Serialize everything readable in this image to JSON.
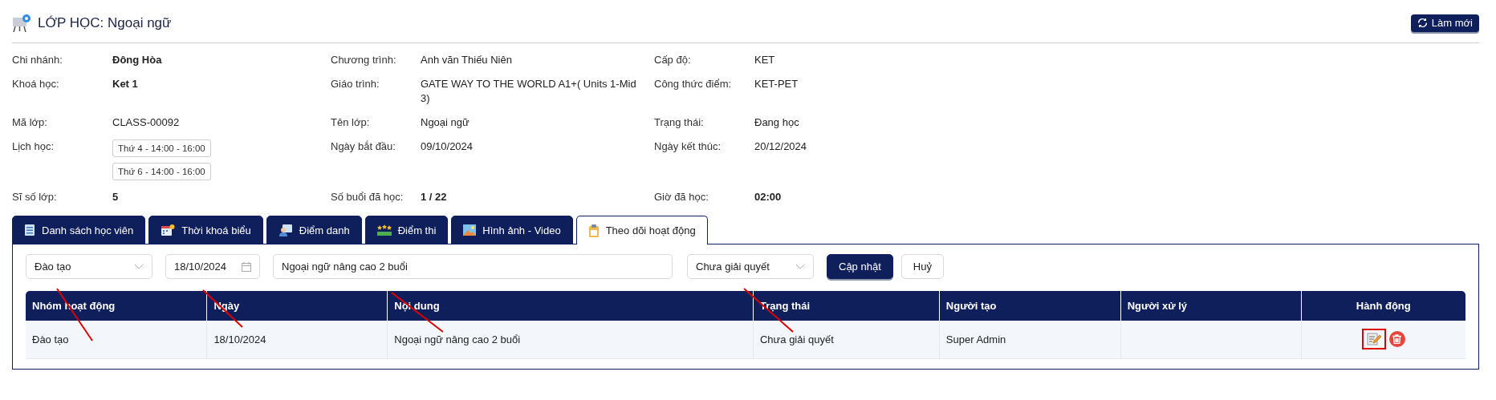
{
  "title": "LỚP HỌC: Ngoại ngữ",
  "refresh_button": "Làm mới",
  "info_rows": [
    [
      {
        "label": "Chi nhánh:",
        "kind": "bold",
        "value": "Đông Hòa"
      },
      {
        "label": "Chương trình:",
        "kind": "text",
        "value": "Anh văn Thiếu Niên"
      },
      {
        "label": "Cấp độ:",
        "kind": "text",
        "value": "KET"
      }
    ],
    [
      {
        "label": "Khoá học:",
        "kind": "bold",
        "value": "Ket 1"
      },
      {
        "label": "Giáo trình:",
        "kind": "text",
        "value": "GATE WAY TO THE WORLD A1+( Units 1-Mid 3)"
      },
      {
        "label": "Công thức điểm:",
        "kind": "text",
        "value": "KET-PET"
      }
    ],
    [
      {
        "label": "Mã lớp:",
        "kind": "text",
        "value": "CLASS-00092"
      },
      {
        "label": "Tên lớp:",
        "kind": "text",
        "value": "Ngoại ngữ"
      },
      {
        "label": "Trạng thái:",
        "kind": "text",
        "value": "Đang học"
      }
    ],
    [
      {
        "label": "Lịch học:",
        "kind": "chips",
        "chips": [
          "Thứ 4 - 14:00 - 16:00",
          "Thứ 6 - 14:00 - 16:00"
        ]
      },
      {
        "label": "Ngày bắt đầu:",
        "kind": "text",
        "value": "09/10/2024"
      },
      {
        "label": "Ngày kết thúc:",
        "kind": "text",
        "value": "20/12/2024"
      }
    ],
    [
      {
        "label": "Sĩ số lớp:",
        "kind": "bold",
        "value": "5"
      },
      {
        "label": "Số buổi đã học:",
        "kind": "bold",
        "value": "1 / 22"
      },
      {
        "label": "Giờ đã học:",
        "kind": "bold",
        "value": "02:00"
      }
    ]
  ],
  "tabs": [
    {
      "label": "Danh sách học viên",
      "selected": false
    },
    {
      "label": "Thời khoá biểu",
      "selected": false
    },
    {
      "label": "Điểm danh",
      "selected": false
    },
    {
      "label": "Điểm thi",
      "selected": false
    },
    {
      "label": "Hình ảnh - Video",
      "selected": false
    },
    {
      "label": "Theo dõi hoạt động",
      "selected": true
    }
  ],
  "filters": {
    "group": "Đào tạo",
    "date": "18/10/2024",
    "content": "Ngoại ngữ nâng cao 2 buổi",
    "status": "Chưa giải quyết",
    "update_button": "Cập nhật",
    "cancel_button": "Huỷ"
  },
  "table": {
    "columns": [
      "Nhóm hoạt động",
      "Ngày",
      "Nội dung",
      "Trạng thái",
      "Người tạo",
      "Người xử lý",
      "Hành động"
    ],
    "rows": [
      {
        "cells": [
          "Đào tạo",
          "18/10/2024",
          "Ngoại ngữ nâng cao 2 buổi",
          "Chưa giải quyết",
          "Super Admin",
          ""
        ],
        "edit_highlighted": true
      }
    ]
  }
}
